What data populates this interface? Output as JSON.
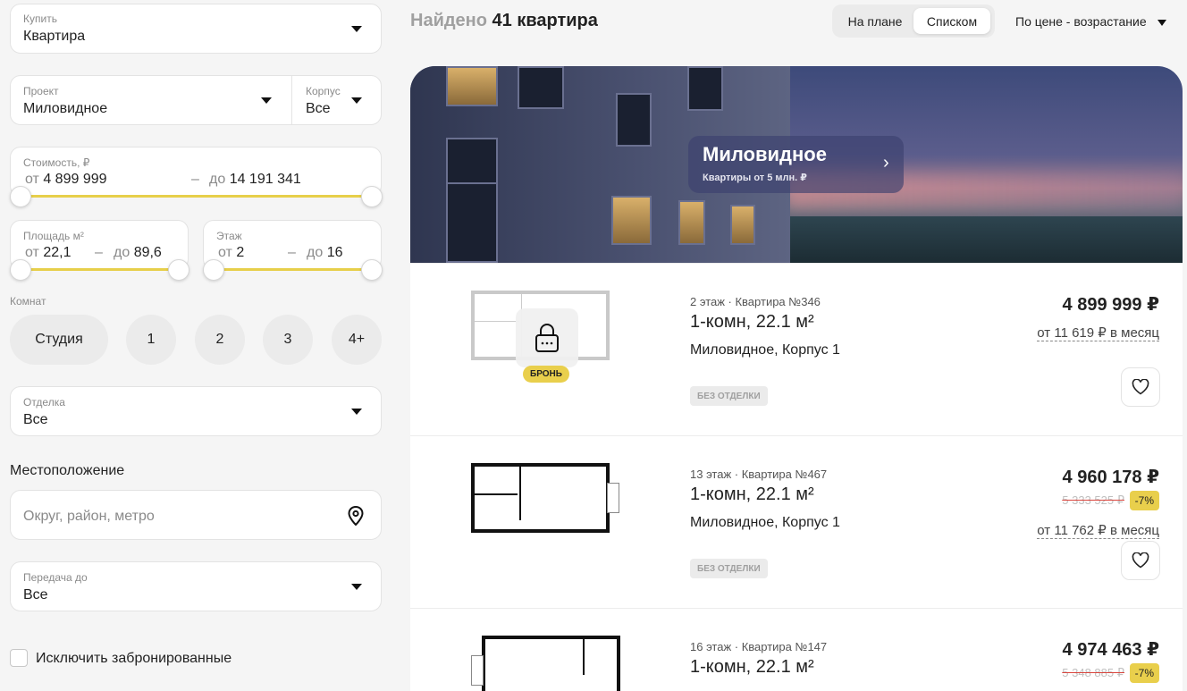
{
  "filters": {
    "buy": {
      "label": "Купить",
      "value": "Квартира"
    },
    "project": {
      "label": "Проект",
      "value": "Миловидное"
    },
    "korpus": {
      "label": "Корпус",
      "value": "Все"
    },
    "cost": {
      "label": "Стоимость, ₽",
      "from_prefix": "от",
      "from": "4 899 999",
      "dash": "–",
      "to_prefix": "до",
      "to": "14 191 341"
    },
    "area": {
      "label": "Площадь м²",
      "from_prefix": "от",
      "from": "22,1",
      "dash": "–",
      "to_prefix": "до",
      "to": "89,6"
    },
    "floor": {
      "label": "Этаж",
      "from_prefix": "от",
      "from": "2",
      "dash": "–",
      "to_prefix": "до",
      "to": "16"
    },
    "rooms": {
      "label": "Комнат",
      "options": [
        "Студия",
        "1",
        "2",
        "3",
        "4+"
      ]
    },
    "finish": {
      "label": "Отделка",
      "value": "Все"
    },
    "location": {
      "title": "Местоположение",
      "placeholder": "Округ, район, метро"
    },
    "handover": {
      "label": "Передача до",
      "value": "Все"
    },
    "exclude_booked": {
      "label": "Исключить забронированные",
      "checked": false
    }
  },
  "header": {
    "found_prefix": "Найдено",
    "found_count": "41 квартира",
    "view_toggle": [
      "На плане",
      "Списком"
    ],
    "view_active": "Списком",
    "sort": "По цене - возрастание"
  },
  "banner": {
    "title": "Миловидное",
    "subtitle": "Квартиры от 5 млн. ₽"
  },
  "listings": [
    {
      "meta": "2 этаж · Квартира №346",
      "type": "1-комн, 22.1 м²",
      "address": "Миловидное, Корпус 1",
      "finish": "БЕЗ ОТДЕЛКИ",
      "price": "4 899 999 ₽",
      "monthly": "от 11 619 ₽ в месяц",
      "booked_label": "БРОНЬ"
    },
    {
      "meta": "13 этаж · Квартира №467",
      "type": "1-комн, 22.1 м²",
      "address": "Миловидное, Корпус 1",
      "finish": "БЕЗ ОТДЕЛКИ",
      "price": "4 960 178 ₽",
      "old_price": "5 333 525 ₽",
      "discount": "-7%",
      "monthly": "от 11 762 ₽ в месяц"
    },
    {
      "meta": "16 этаж · Квартира №147",
      "type": "1-комн, 22.1 м²",
      "price": "4 974 463 ₽",
      "old_price": "5 348 885 ₽",
      "discount": "-7%"
    }
  ],
  "colors": {
    "accent": "#e7cf4a",
    "discount_strike": "#d9443c",
    "bg": "#f5f5f5"
  }
}
